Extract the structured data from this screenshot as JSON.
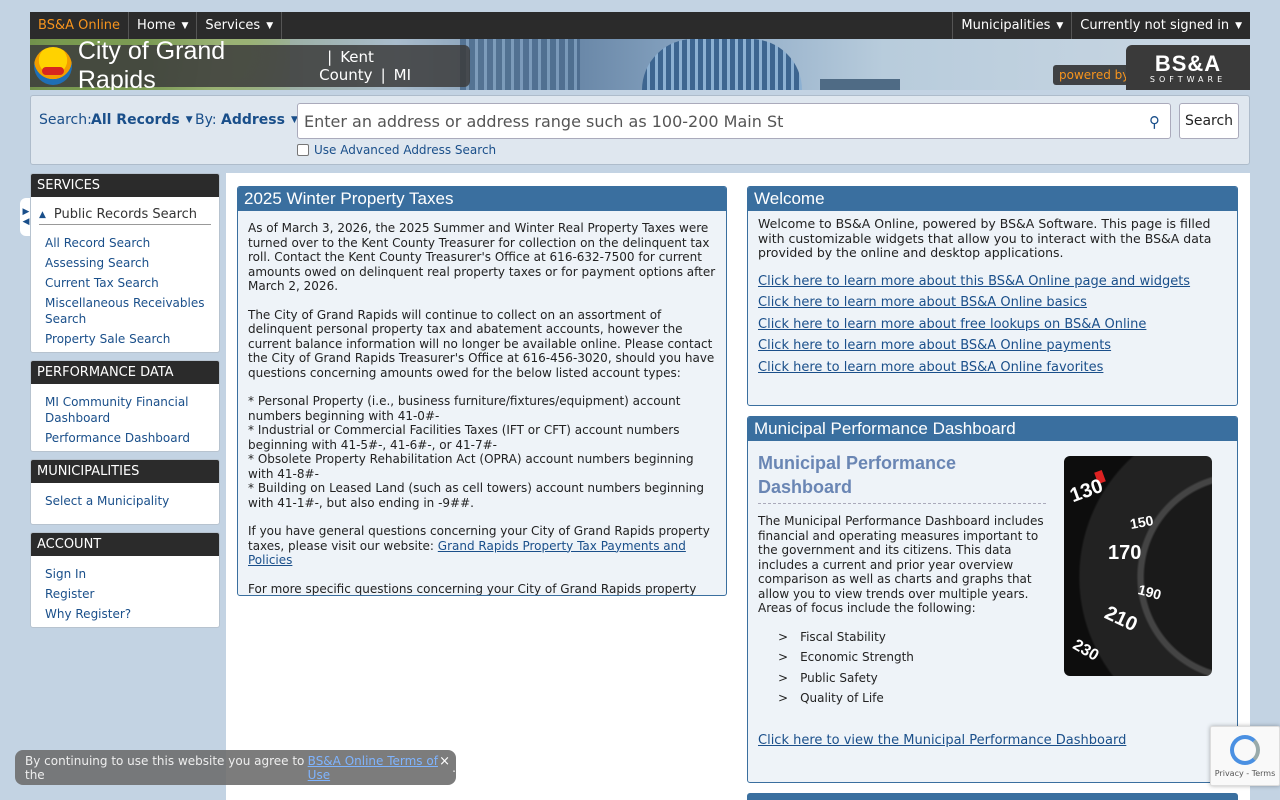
{
  "topnav": {
    "brand": "BS&A Online",
    "home": "Home",
    "services": "Services",
    "municipalities": "Municipalities",
    "signin": "Currently not signed in"
  },
  "banner": {
    "city": "City of Grand Rapids",
    "county": "Kent County",
    "state": "MI",
    "powered": "powered by",
    "logo_big": "BS&A",
    "logo_small": "SOFTWARE"
  },
  "search": {
    "label": "Search:",
    "records": "All Records",
    "by_label": "By:",
    "by": "Address",
    "placeholder": "Enter an address or address range such as 100-200 Main St",
    "button": "Search",
    "advanced": "Use Advanced Address Search"
  },
  "sidebar": {
    "services": {
      "title": "SERVICES",
      "subheader": "Public Records Search",
      "links": [
        "All Record Search",
        "Assessing Search",
        "Current Tax Search",
        "Miscellaneous Receivables Search",
        "Property Sale Search"
      ]
    },
    "performance": {
      "title": "PERFORMANCE DATA",
      "links": [
        "MI Community Financial Dashboard",
        "Performance Dashboard"
      ]
    },
    "municipalities": {
      "title": "MUNICIPALITIES",
      "links": [
        "Select a Municipality"
      ]
    },
    "account": {
      "title": "ACCOUNT",
      "links": [
        "Sign In",
        "Register",
        "Why Register?"
      ]
    }
  },
  "winter": {
    "title": "2025 Winter Property Taxes",
    "p1": "As of March 3, 2026, the 2025 Summer and Winter Real Property Taxes were turned over to the Kent County Treasurer for collection on the delinquent tax roll. Contact the Kent County Treasurer's Office at 616-632-7500 for current amounts owed on delinquent real property taxes or for payment options after March 2, 2026.",
    "p2": "The City of Grand Rapids will continue to collect on an assortment of delinquent personal property tax and abatement accounts, however the current balance information will no longer be available online. Please contact the City of Grand Rapids Treasurer's Office at 616-456-3020, should you have questions concerning amounts owed for the below listed account types:",
    "b1": "* Personal Property (i.e., business furniture/fixtures/equipment) account numbers beginning with 41-0#-",
    "b2": "* Industrial or Commercial Facilities Taxes (IFT or CFT) account numbers beginning with 41-5#-, 41-6#-, or 41-7#-",
    "b3": "* Obsolete Property Rehabilitation Act (OPRA) account numbers beginning with 41-8#-",
    "b4": "* Building on Leased Land (such as cell towers) account numbers beginning with 41-1#-, but also ending in -9##.",
    "p3": "If you have general questions concerning your City of Grand Rapids property taxes, please visit our website:",
    "p3_link": "Grand Rapids Property Tax Payments and Policies",
    "p4": "For more specific questions concerning your City of Grand Rapids property taxes, please contact the City Treasurer's Office at 616-456-3020 or dial 311 locally to speak with one of our 311 Customer Service Agents. Thank you."
  },
  "welcome": {
    "title": "Welcome",
    "intro": "Welcome to BS&A Online, powered by BS&A Software. This page is filled with customizable widgets that allow you to interact with the BS&A data provided by the online and desktop applications.",
    "links": [
      "Click here to learn more about this BS&A Online page and widgets",
      "Click here to learn more about BS&A Online basics",
      "Click here to learn more about free lookups on BS&A Online",
      "Click here to learn more about BS&A Online payments",
      "Click here to learn more about BS&A Online favorites"
    ]
  },
  "mpd": {
    "title": "Municipal Performance Dashboard",
    "heading": "Municipal Performance Dashboard",
    "body": "The Municipal Performance Dashboard includes financial and operating measures important to the government and its citizens.  This data includes a current and prior year overview comparison as well as charts and graphs that allow you to view trends over multiple years.  Areas of focus include the following:",
    "bullets": [
      "Fiscal Stability",
      "Economic Strength",
      "Public Safety",
      "Quality of Life"
    ],
    "link": "Click here to view the Municipal Performance Dashboard",
    "gauge": [
      "130",
      "150",
      "170",
      "190",
      "210",
      "230"
    ]
  },
  "cookie": {
    "text": "By continuing to use this website you agree to the",
    "link": "BS&A Online Terms of Use",
    "close": "×"
  },
  "recaptcha": {
    "text": "Privacy - Terms"
  }
}
